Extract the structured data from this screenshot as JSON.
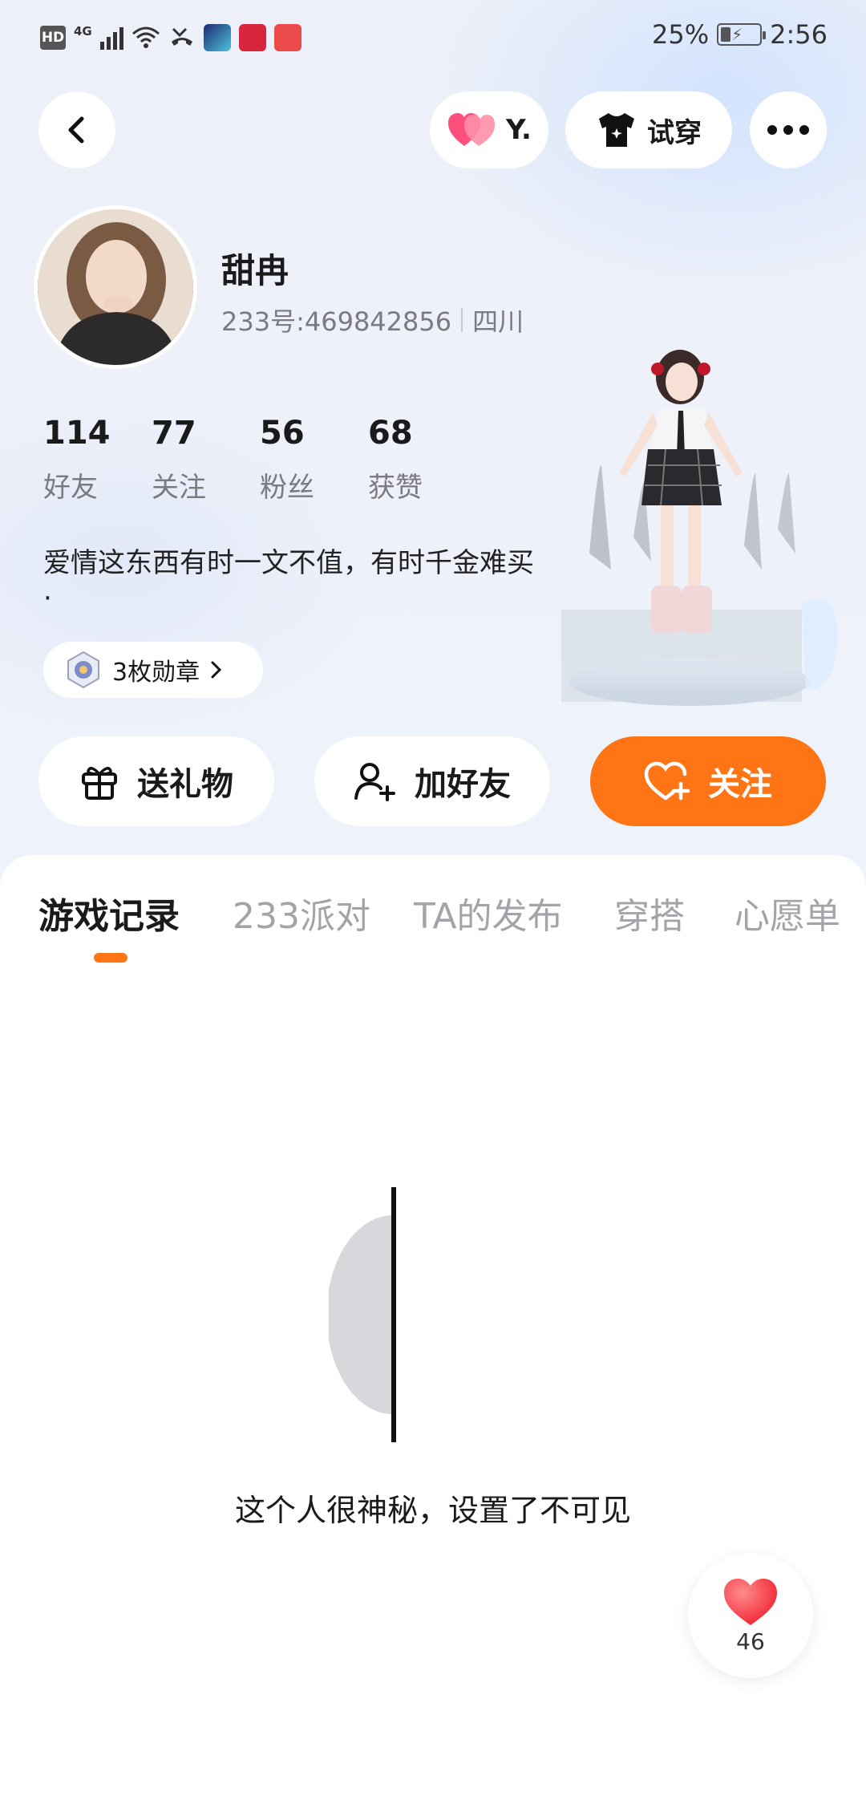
{
  "status_bar": {
    "hd": "HD",
    "network": "4G",
    "battery_percent": "25%",
    "time": "2:56"
  },
  "top_nav": {
    "heart_label": "Y.",
    "try_on_label": "试穿"
  },
  "profile": {
    "name": "甜冉",
    "uid": "233号:469842856",
    "location": "四川",
    "stats": [
      {
        "value": "114",
        "label": "好友"
      },
      {
        "value": "77",
        "label": "关注"
      },
      {
        "value": "56",
        "label": "粉丝"
      },
      {
        "value": "68",
        "label": "获赞"
      }
    ],
    "bio_line1": "爱情这东西有时一文不值，有时千金难买",
    "bio_line2": "·",
    "medals_label": "3枚勋章"
  },
  "actions": {
    "gift_label": "送礼物",
    "add_friend_label": "加好友",
    "follow_label": "关注"
  },
  "tabs": [
    {
      "label": "游戏记录"
    },
    {
      "label": "233派对"
    },
    {
      "label": "TA的发布"
    },
    {
      "label": "穿搭"
    },
    {
      "label": "心愿单"
    }
  ],
  "empty_state": {
    "message": "这个人很神秘，设置了不可见"
  },
  "like_fab": {
    "count": "46"
  },
  "colors": {
    "accent": "#ff7414",
    "muted_text": "#7a7a80",
    "inactive_tab": "#a3a3aa"
  }
}
